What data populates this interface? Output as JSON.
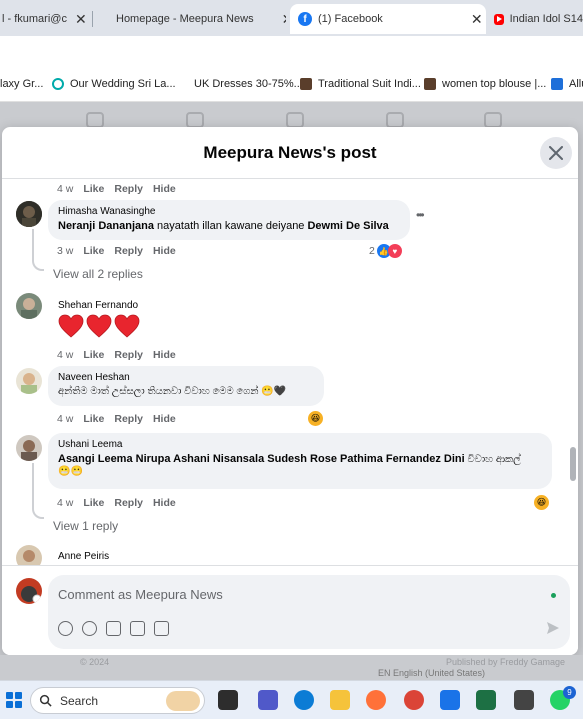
{
  "browser": {
    "tabs": [
      {
        "title": "l - fkumari@c",
        "active": false
      },
      {
        "title": "Homepage - Meepura News",
        "active": false
      },
      {
        "title": "(1) Facebook",
        "active": true
      },
      {
        "title": "Indian Idol S14",
        "active": false
      }
    ],
    "bookmarks": [
      "laxy Gr...",
      "Our Wedding Sri La...",
      "UK Dresses 30-75%...",
      "Traditional Suit Indi...",
      "women top blouse |...",
      "Allu"
    ]
  },
  "modal": {
    "title": "Meepura News's post"
  },
  "comments": {
    "top_meta": {
      "time": "4 w",
      "like": "Like",
      "reply": "Reply",
      "hide": "Hide"
    },
    "items": [
      {
        "name": "Himasha Wanasinghe",
        "mention1": "Neranji Dananjana",
        "text_mid": " nayatath illan kawane deiyane ",
        "mention2": "Dewmi De Silva",
        "time": "3 w",
        "like": "Like",
        "reply": "Reply",
        "hide": "Hide",
        "reaction_count": "2",
        "more": "•••"
      },
      {
        "view_replies": "View all 2 replies"
      },
      {
        "name": "Shehan Fernando",
        "time": "4 w",
        "like": "Like",
        "reply": "Reply",
        "hide": "Hide"
      },
      {
        "name": "Naveen Heshan",
        "text": "අන්තිම මාත් උස්සලා තියනවා විවාහ මෙම ගෙන්",
        "time": "4 w",
        "like": "Like",
        "reply": "Reply",
        "hide": "Hide"
      },
      {
        "name": "Ushani Leema",
        "mentions": "Asangi Leema Nirupa Ashani Nisansala Sudesh Rose Pathima Fernandez Dini",
        "suffix": " විවාහ ආකල්",
        "time": "4 w",
        "like": "Like",
        "reply": "Reply",
        "hide": "Hide"
      },
      {
        "view_replies": "View 1 reply"
      },
      {
        "name": "Anne Peiris"
      }
    ]
  },
  "composer": {
    "placeholder": "Comment as Meepura News"
  },
  "page_footer": {
    "copyright": "© 2024",
    "published_by": "Published by Freddy Gamage",
    "language": "EN English (United States)"
  },
  "taskbar": {
    "search_label": "Search",
    "notification_count": "9"
  },
  "colors": {
    "facebook_blue": "#1877f2",
    "bubble": "#f0f2f5",
    "meta_text": "#65676b"
  }
}
